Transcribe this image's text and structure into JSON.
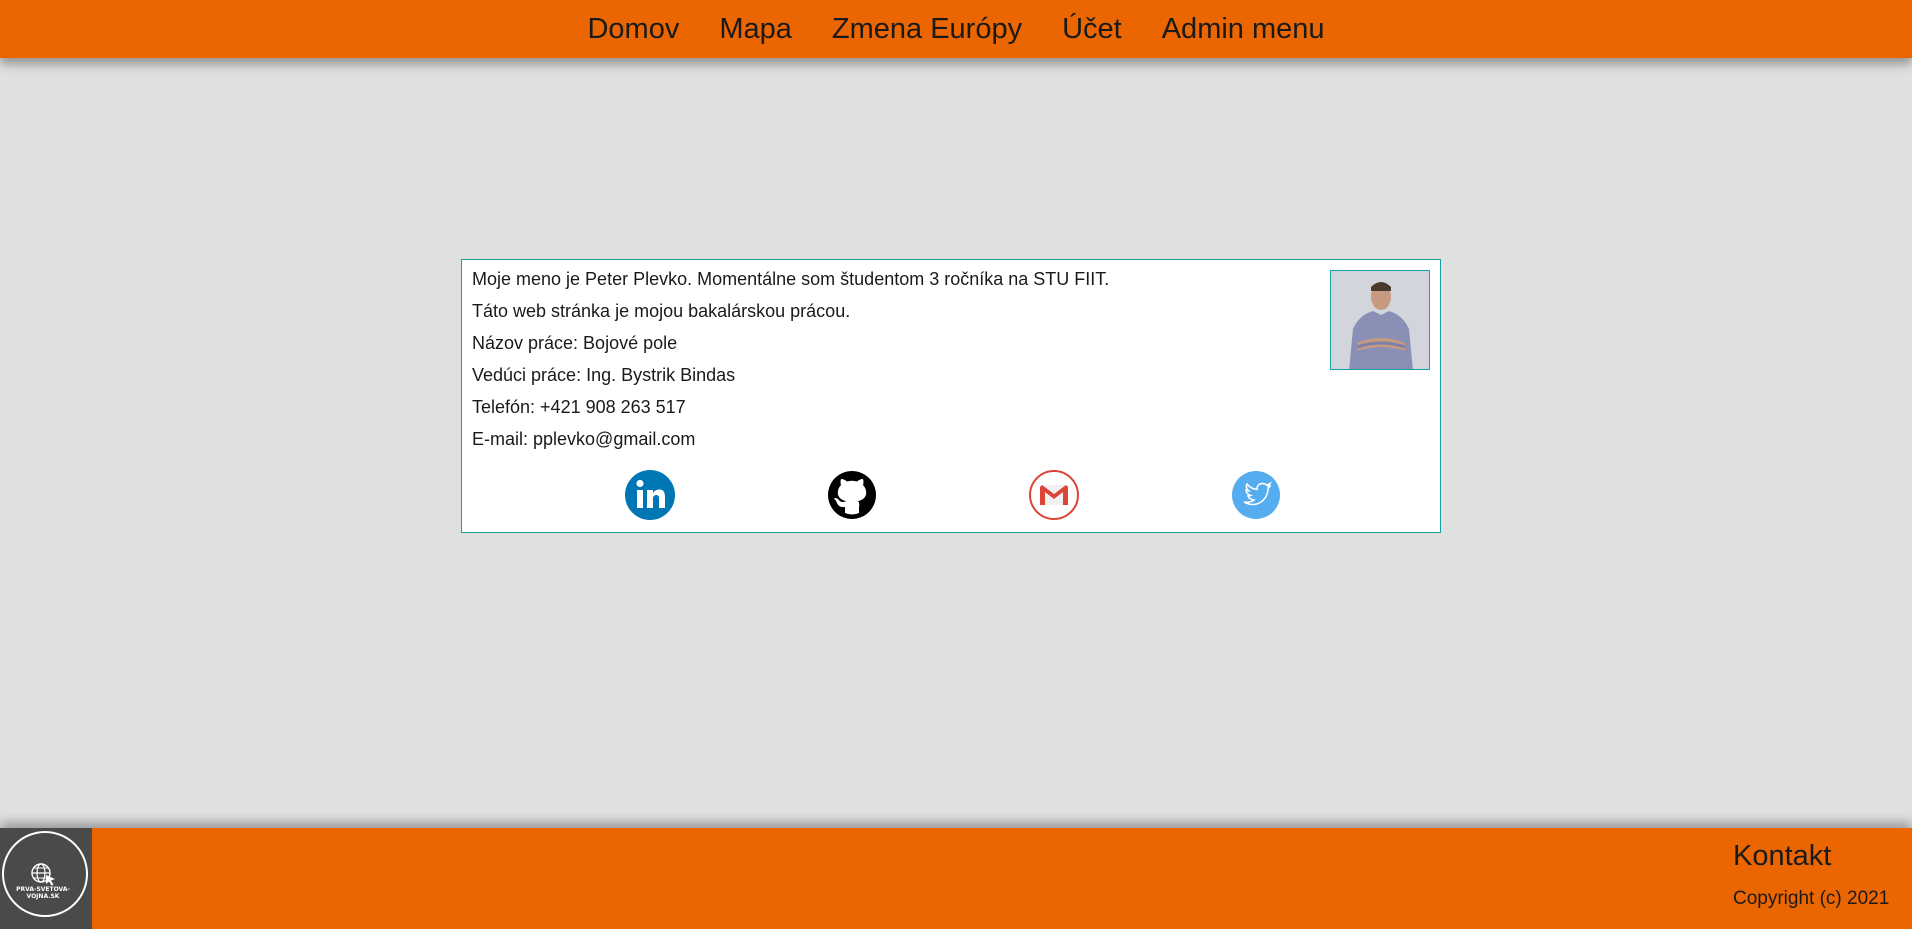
{
  "nav": {
    "items": [
      {
        "label": "Domov"
      },
      {
        "label": "Mapa"
      },
      {
        "label": "Zmena Európy"
      },
      {
        "label": "Účet"
      },
      {
        "label": "Admin menu"
      }
    ]
  },
  "card": {
    "lines": [
      "Moje meno je Peter Plevko. Momentálne som študentom 3 ročníka na STU FIIT.",
      "Táto web stránka je mojou bakalárskou prácou.",
      "Názov práce: Bojové pole",
      "Vedúci práce: Ing. Bystrik Bindas",
      "Telefón: +421 908 263 517",
      "E-mail: pplevko@gmail.com"
    ],
    "social": [
      {
        "icon": "linkedin-icon",
        "color": "#0077b5"
      },
      {
        "icon": "github-icon",
        "color": "#000000"
      },
      {
        "icon": "gmail-icon",
        "color": "#db4437"
      },
      {
        "icon": "twitter-icon",
        "color": "#55acee"
      }
    ]
  },
  "footer": {
    "logo_text": "PRVA-SVETOVA-VOJNA.SK",
    "contact": "Kontakt",
    "copyright": "Copyright (c) 2021"
  },
  "colors": {
    "accent": "#eb6600",
    "border": "#17a2a2",
    "background": "#e0e0e0"
  }
}
